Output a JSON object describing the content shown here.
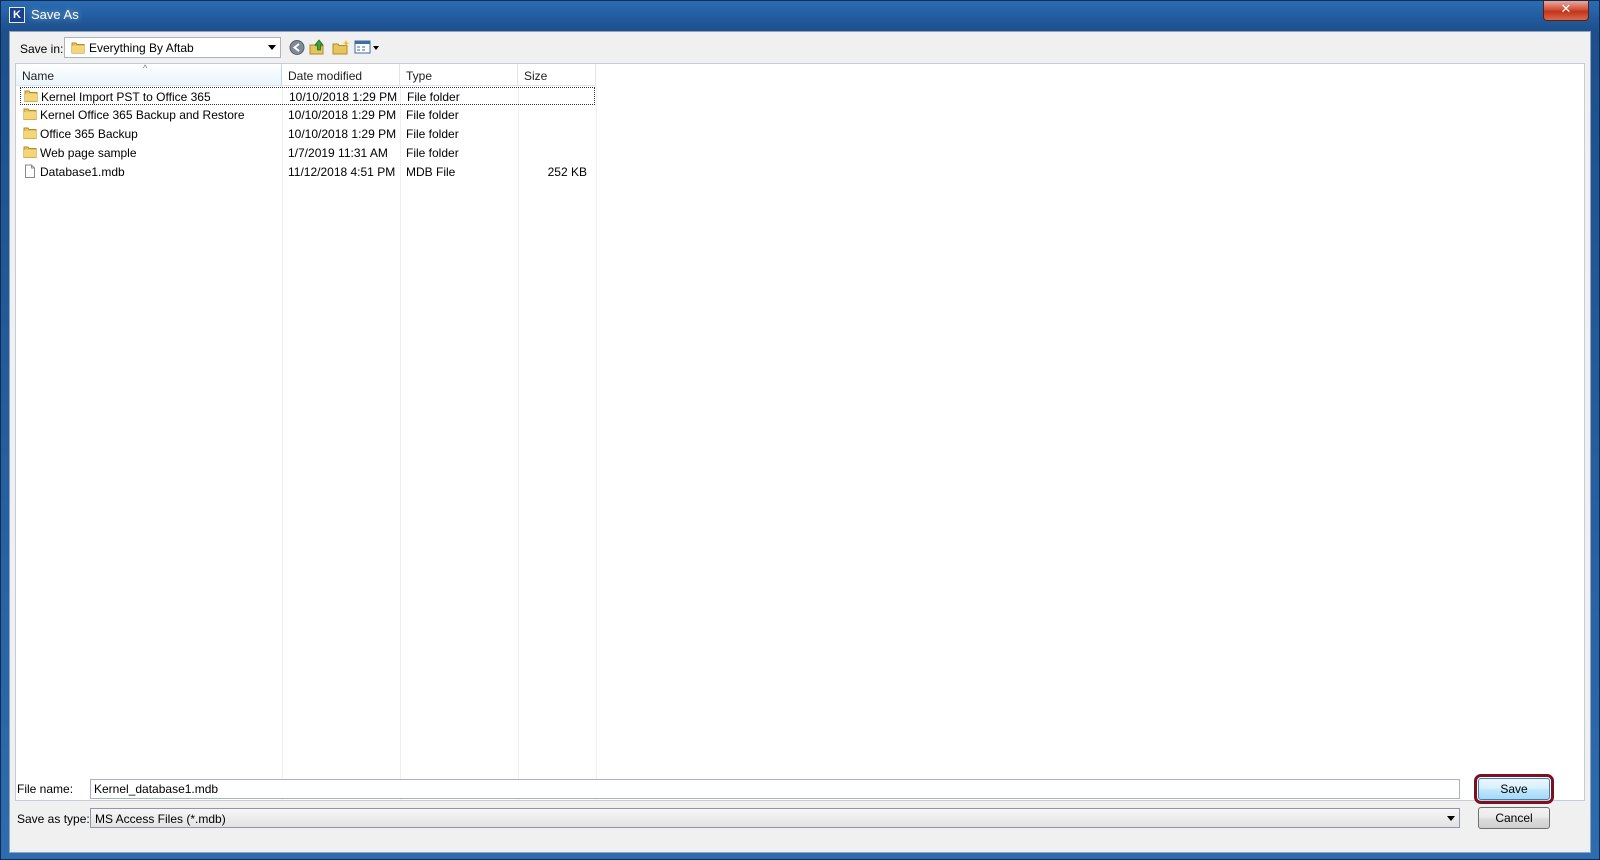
{
  "window": {
    "title": "Save As",
    "app_icon_letter": "K",
    "close_glyph": "✕"
  },
  "toolbar": {
    "save_in_label": "Save in:",
    "save_in_value": "Everything By Aftab"
  },
  "columns": {
    "name": "Name",
    "date": "Date modified",
    "type": "Type",
    "size": "Size"
  },
  "files": [
    {
      "name": "Kernel Import PST to Office 365",
      "date": "10/10/2018 1:29 PM",
      "type": "File folder",
      "size": "",
      "icon": "folder-icon"
    },
    {
      "name": "Kernel Office 365 Backup and Restore",
      "date": "10/10/2018 1:29 PM",
      "type": "File folder",
      "size": "",
      "icon": "folder-icon"
    },
    {
      "name": "Office 365 Backup",
      "date": "10/10/2018 1:29 PM",
      "type": "File folder",
      "size": "",
      "icon": "folder-icon"
    },
    {
      "name": "Web page sample",
      "date": "1/7/2019 11:31 AM",
      "type": "File folder",
      "size": "",
      "icon": "folder-icon"
    },
    {
      "name": "Database1.mdb",
      "date": "11/12/2018 4:51 PM",
      "type": "MDB File",
      "size": "252 KB",
      "icon": "file-icon"
    }
  ],
  "form": {
    "file_name_label": "File name:",
    "file_name_value": "Kernel_database1.mdb",
    "save_type_label": "Save as type:",
    "save_type_value": "MS Access Files (*.mdb)",
    "save_button": "Save",
    "cancel_button": "Cancel"
  },
  "colors": {
    "title_bar": "#2a6db4",
    "highlight_outline": "#7d1020",
    "close_button": "#c4331b"
  }
}
